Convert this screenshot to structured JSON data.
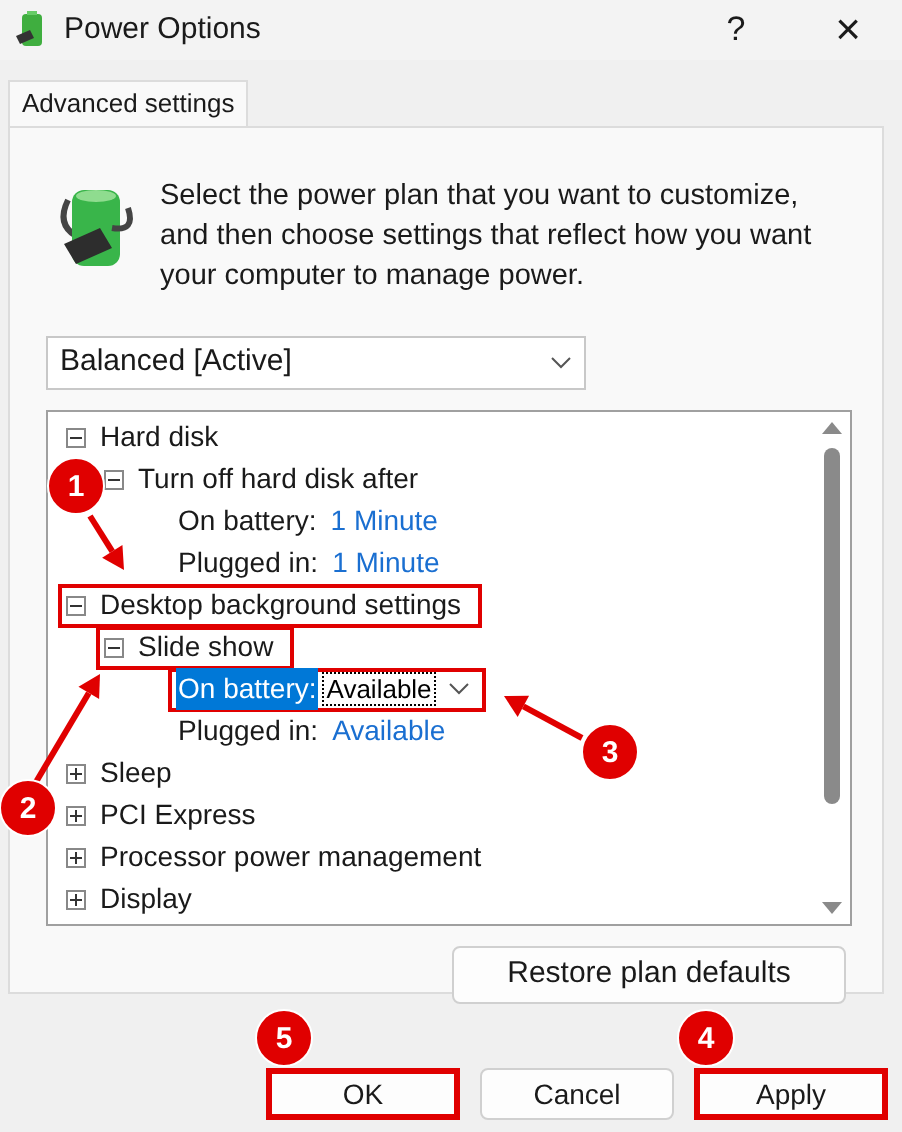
{
  "window": {
    "title": "Power Options",
    "help": "?",
    "close": "×"
  },
  "tabs": [
    {
      "label": "Advanced settings",
      "selected": true
    }
  ],
  "intro": "Select the power plan that you want to customize, and then choose settings that reflect how you want your computer to manage power.",
  "plan_dropdown": {
    "value": "Balanced [Active]"
  },
  "tree": [
    {
      "label": "Hard disk",
      "expanded": true,
      "highlighted": false,
      "children": [
        {
          "label": "Turn off hard disk after",
          "expanded": true,
          "highlighted": false,
          "children": [
            {
              "kind": "setting",
              "label": "On battery:",
              "value": "1 Minute",
              "selected": false,
              "highlighted": false
            },
            {
              "kind": "setting",
              "label": "Plugged in:",
              "value": "1 Minute",
              "selected": false,
              "highlighted": false
            }
          ]
        }
      ]
    },
    {
      "label": "Desktop background settings",
      "expanded": true,
      "highlighted": true,
      "children": [
        {
          "label": "Slide show",
          "expanded": true,
          "highlighted": true,
          "children": [
            {
              "kind": "setting",
              "label": "On battery:",
              "value": "Available",
              "selected": true,
              "highlighted": true
            },
            {
              "kind": "setting",
              "label": "Plugged in:",
              "value": "Available",
              "selected": false,
              "highlighted": false
            }
          ]
        }
      ]
    },
    {
      "label": "Sleep",
      "expanded": false,
      "highlighted": false
    },
    {
      "label": "PCI Express",
      "expanded": false,
      "highlighted": false
    },
    {
      "label": "Processor power management",
      "expanded": false,
      "highlighted": false
    },
    {
      "label": "Display",
      "expanded": false,
      "highlighted": false
    }
  ],
  "restore_button": "Restore plan defaults",
  "buttons": [
    {
      "label": "OK",
      "highlighted": true
    },
    {
      "label": "Cancel",
      "highlighted": false
    },
    {
      "label": "Apply",
      "highlighted": true
    }
  ],
  "annotations": [
    {
      "number": "1"
    },
    {
      "number": "2"
    },
    {
      "number": "3"
    },
    {
      "number": "4"
    },
    {
      "number": "5"
    }
  ]
}
